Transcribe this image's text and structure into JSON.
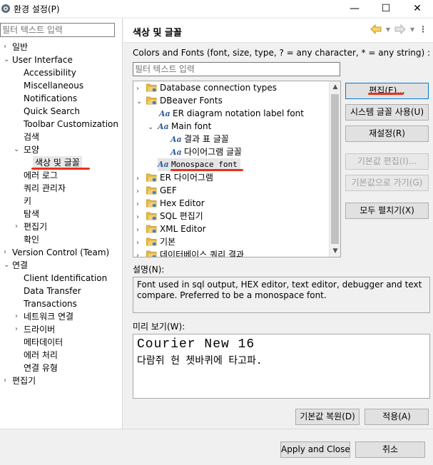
{
  "window": {
    "title": "환경 설정(P)",
    "minimize": "—",
    "maximize": "☐",
    "close": "✕"
  },
  "left": {
    "filter_placeholder": "필터 텍스트 입력",
    "items": [
      {
        "label": "일반"
      },
      {
        "label": "User Interface"
      },
      {
        "label": "Accessibility"
      },
      {
        "label": "Miscellaneous"
      },
      {
        "label": "Notifications"
      },
      {
        "label": "Quick Search"
      },
      {
        "label": "Toolbar Customization"
      },
      {
        "label": "검색"
      },
      {
        "label": "모양"
      },
      {
        "label": "색상 및 글꼴"
      },
      {
        "label": "에러 로그"
      },
      {
        "label": "쿼리 관리자"
      },
      {
        "label": "키"
      },
      {
        "label": "탐색"
      },
      {
        "label": "편집기"
      },
      {
        "label": "확인"
      },
      {
        "label": "Version Control (Team)"
      },
      {
        "label": "연결"
      },
      {
        "label": "Client Identification"
      },
      {
        "label": "Data Transfer"
      },
      {
        "label": "Transactions"
      },
      {
        "label": "네트워크 연결"
      },
      {
        "label": "드라이버"
      },
      {
        "label": "메타데이터"
      },
      {
        "label": "에러 처리"
      },
      {
        "label": "연결 유형"
      },
      {
        "label": "편집기"
      }
    ]
  },
  "page": {
    "title": "색상 및 글꼴",
    "description": "Colors and Fonts (font, size, type, ? = any character, * = any string) :",
    "filter_placeholder": "필터 텍스트 입력"
  },
  "font_tree": [
    {
      "label": "Database connection types"
    },
    {
      "label": "DBeaver Fonts"
    },
    {
      "label": "ER diagram notation label font"
    },
    {
      "label": "Main font"
    },
    {
      "label": "결과 표 글꼴"
    },
    {
      "label": "다이어그램 글꼴"
    },
    {
      "label": "Monospace font"
    },
    {
      "label": "ER 다이어그램"
    },
    {
      "label": "GEF"
    },
    {
      "label": "Hex Editor"
    },
    {
      "label": "SQL 편집기"
    },
    {
      "label": "XML Editor"
    },
    {
      "label": "기본"
    },
    {
      "label": "데이터베이스 쿼리 결과"
    }
  ],
  "buttons": {
    "edit": "편집(E)...",
    "use_system_font": "시스템 글꼴 사용(U)",
    "reset": "재설정(R)",
    "edit_default": "기본값 편집(I)...",
    "goto_default": "기본값으로 가기(G)",
    "expand_all": "모두 펼치기(X)",
    "restore_defaults": "기본값 복원(D)",
    "apply": "적용(A)",
    "apply_and_close": "Apply and Close",
    "cancel": "취소"
  },
  "description": {
    "label": "설명(N):",
    "text": "Font used in sql output, HEX editor, text editor, debugger and text compare. Preferred to be a monospace font."
  },
  "preview": {
    "label": "미리 보기(W):",
    "line1": "Courier New 16",
    "line2": "다람쥐 헌 쳇바퀴에 타고파."
  },
  "icons": {
    "back": "back-arrow-icon",
    "folder_color": "#d9a72b",
    "accent": "#0078d7",
    "annotation": "#e8311d"
  }
}
